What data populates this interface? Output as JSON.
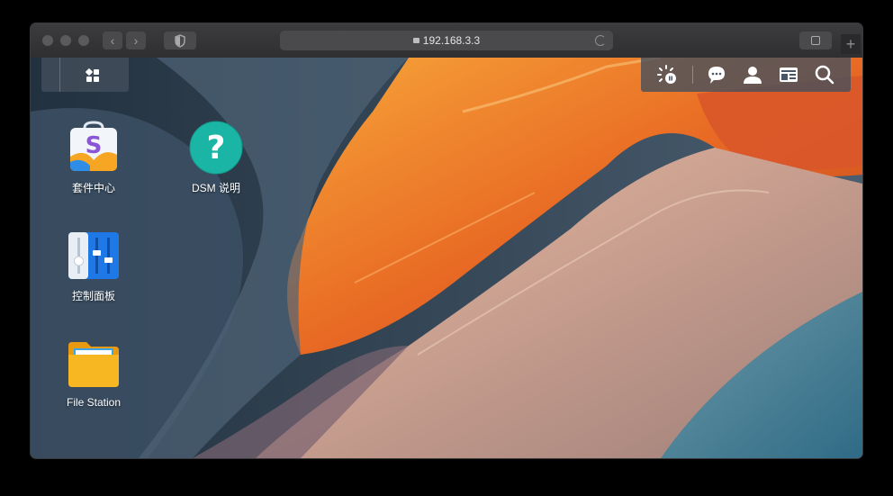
{
  "browser": {
    "url": "192.168.3.3",
    "back_icon": "chevron-left",
    "forward_icon": "chevron-right",
    "plus_label": "+"
  },
  "dsm": {
    "taskbar_right_icons": [
      "background-tasks-icon",
      "notifications-icon",
      "user-icon",
      "widgets-icon",
      "search-icon"
    ],
    "desktop_apps": [
      {
        "label": "套件中心",
        "icon": "package-center-icon"
      },
      {
        "label": "DSM 说明",
        "icon": "help-icon",
        "glyph": "?"
      },
      {
        "label": "控制面板",
        "icon": "control-panel-icon"
      },
      {
        "label": "File Station",
        "icon": "file-station-icon"
      }
    ]
  },
  "colors": {
    "help_teal": "#1bb5a5",
    "folder_yellow": "#f7b722",
    "control_blue": "#1e78e6"
  }
}
